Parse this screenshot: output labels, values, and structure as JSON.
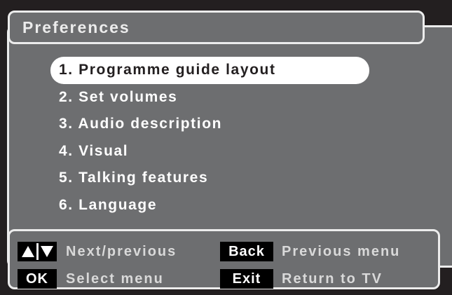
{
  "screen": {
    "title": "Preferences"
  },
  "menu": {
    "items": [
      {
        "label": "1. Programme guide layout",
        "selected": true
      },
      {
        "label": "2. Set volumes",
        "selected": false
      },
      {
        "label": "3. Audio description",
        "selected": false
      },
      {
        "label": "4. Visual",
        "selected": false
      },
      {
        "label": "5. Talking features",
        "selected": false
      },
      {
        "label": "6. Language",
        "selected": false
      }
    ]
  },
  "footer": {
    "arrows_key_icon": "up-down-arrow-icons",
    "arrows_label": "Next/previous",
    "ok_key": "OK",
    "ok_label": "Select menu",
    "back_key": "Back",
    "back_label": "Previous menu",
    "exit_key": "Exit",
    "exit_label": "Return to TV"
  },
  "colors": {
    "frame": "#231f20",
    "panel": "#6d6e70",
    "outline": "#ececec",
    "highlight": "#ffffff",
    "key_background": "#000000"
  }
}
